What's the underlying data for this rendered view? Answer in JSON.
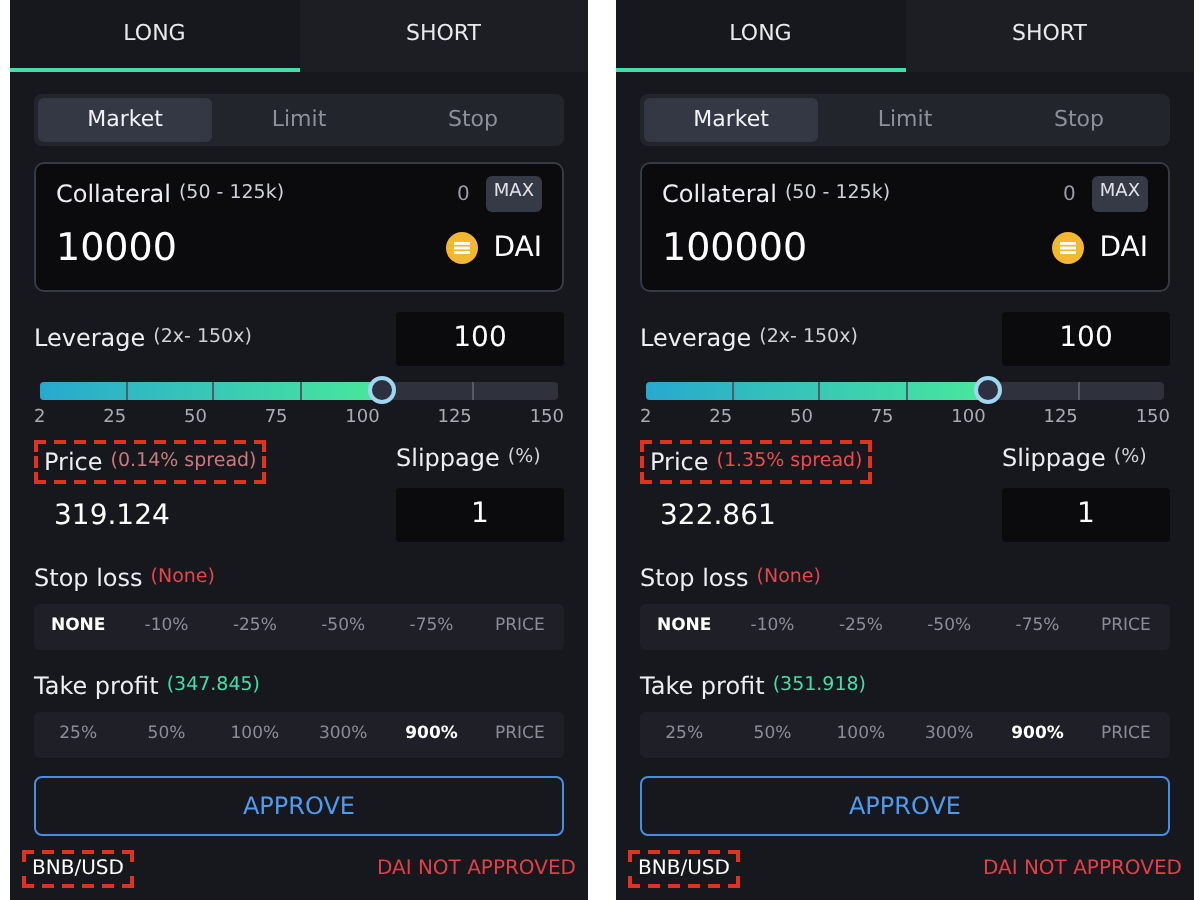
{
  "panels": [
    {
      "side_tabs": [
        {
          "label": "LONG",
          "selected": true
        },
        {
          "label": "SHORT",
          "selected": false
        }
      ],
      "order_types": [
        {
          "label": "Market",
          "selected": true
        },
        {
          "label": "Limit",
          "selected": false
        },
        {
          "label": "Stop",
          "selected": false
        }
      ],
      "collateral": {
        "label": "Collateral",
        "range": "(50 - 125k)",
        "balance": "0",
        "max_button": "MAX",
        "value": "10000",
        "token": "DAI"
      },
      "leverage": {
        "label": "Leverage",
        "range": "(2x- 150x)",
        "value": "100",
        "level": 0.662,
        "ticks": [
          "2",
          "25",
          "50",
          "75",
          "100",
          "125",
          "150"
        ]
      },
      "price": {
        "label": "Price",
        "spread": "(0.14% spread)",
        "color": "#c97a7d",
        "value": "319.124",
        "highlighted": true
      },
      "slippage": {
        "label": "Slippage",
        "unit": "(%)",
        "value": "1"
      },
      "stop_loss": {
        "label": "Stop loss",
        "note": "(None)",
        "options": [
          {
            "label": "NONE",
            "selected": true
          },
          {
            "label": "-10%",
            "selected": false
          },
          {
            "label": "-25%",
            "selected": false
          },
          {
            "label": "-50%",
            "selected": false
          },
          {
            "label": "-75%",
            "selected": false
          },
          {
            "label": "PRICE",
            "selected": false
          }
        ]
      },
      "take_profit": {
        "label": "Take profit",
        "note": "(347.845)",
        "options": [
          {
            "label": "25%",
            "selected": false
          },
          {
            "label": "50%",
            "selected": false
          },
          {
            "label": "100%",
            "selected": false
          },
          {
            "label": "300%",
            "selected": false
          },
          {
            "label": "900%",
            "selected": true
          },
          {
            "label": "PRICE",
            "selected": false
          }
        ]
      },
      "approve_button": "APPROVE",
      "pair": {
        "label": "BNB/USD",
        "highlighted": true
      },
      "status": "DAI NOT APPROVED"
    },
    {
      "side_tabs": [
        {
          "label": "LONG",
          "selected": true
        },
        {
          "label": "SHORT",
          "selected": false
        }
      ],
      "order_types": [
        {
          "label": "Market",
          "selected": true
        },
        {
          "label": "Limit",
          "selected": false
        },
        {
          "label": "Stop",
          "selected": false
        }
      ],
      "collateral": {
        "label": "Collateral",
        "range": "(50 - 125k)",
        "balance": "0",
        "max_button": "MAX",
        "value": "100000",
        "token": "DAI"
      },
      "leverage": {
        "label": "Leverage",
        "range": "(2x- 150x)",
        "value": "100",
        "level": 0.662,
        "ticks": [
          "2",
          "25",
          "50",
          "75",
          "100",
          "125",
          "150"
        ]
      },
      "price": {
        "label": "Price",
        "spread": "(1.35% spread)",
        "color": "#ef4a4f",
        "value": "322.861",
        "highlighted": true
      },
      "slippage": {
        "label": "Slippage",
        "unit": "(%)",
        "value": "1"
      },
      "stop_loss": {
        "label": "Stop loss",
        "note": "(None)",
        "options": [
          {
            "label": "NONE",
            "selected": true
          },
          {
            "label": "-10%",
            "selected": false
          },
          {
            "label": "-25%",
            "selected": false
          },
          {
            "label": "-50%",
            "selected": false
          },
          {
            "label": "-75%",
            "selected": false
          },
          {
            "label": "PRICE",
            "selected": false
          }
        ]
      },
      "take_profit": {
        "label": "Take profit",
        "note": "(351.918)",
        "options": [
          {
            "label": "25%",
            "selected": false
          },
          {
            "label": "50%",
            "selected": false
          },
          {
            "label": "100%",
            "selected": false
          },
          {
            "label": "300%",
            "selected": false
          },
          {
            "label": "900%",
            "selected": true
          },
          {
            "label": "PRICE",
            "selected": false
          }
        ]
      },
      "approve_button": "APPROVE",
      "pair": {
        "label": "BNB/USD",
        "highlighted": true
      },
      "status": "DAI NOT APPROVED"
    }
  ]
}
